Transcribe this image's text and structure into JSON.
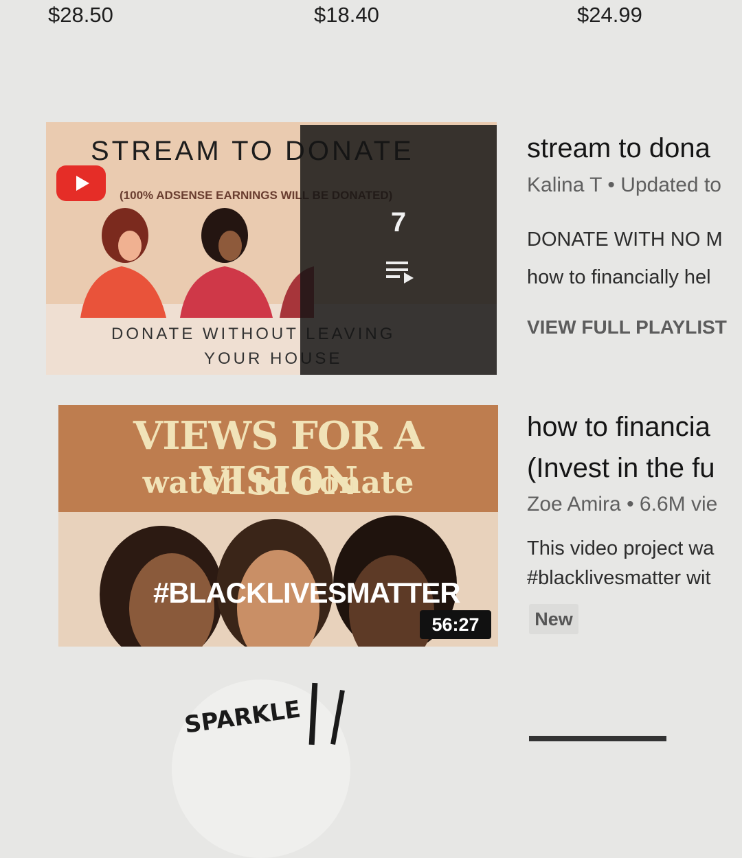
{
  "prices": [
    "$28.50",
    "$18.40",
    "$24.99"
  ],
  "playlist": {
    "thumb": {
      "title": "STREAM TO DONATE",
      "subtitle": "(100% ADSENSE EARNINGS WILL BE DONATED)",
      "bottom_line1": "DONATE WITHOUT LEAVING",
      "bottom_line2": "YOUR HOUSE",
      "video_count": "7"
    },
    "title": "stream to dona",
    "channel": "Kalina T",
    "separator": "•",
    "updated": "Updated to",
    "desc_line1": "DONATE WITH NO M",
    "desc_line2": "how to financially hel",
    "view_full": "VIEW FULL PLAYLIST"
  },
  "video": {
    "thumb": {
      "line1": "VIEWS FOR A VISION",
      "line2": "watch to donate",
      "hashtag": "#BLACKLIVESMATTER",
      "duration": "56:27"
    },
    "title_line1": "how to financia",
    "title_line2": "(Invest in the fu",
    "channel": "Zoe Amira",
    "separator": "•",
    "views": "6.6M vie",
    "desc_line1": "This video project wa",
    "desc_line2": "#blacklivesmatter wit",
    "badge": "New"
  },
  "next_thumb_text": "SPARKLE",
  "colors": {
    "youtube_red": "#e52d27",
    "overlay": "#141414",
    "banner": "#be7d4f"
  }
}
